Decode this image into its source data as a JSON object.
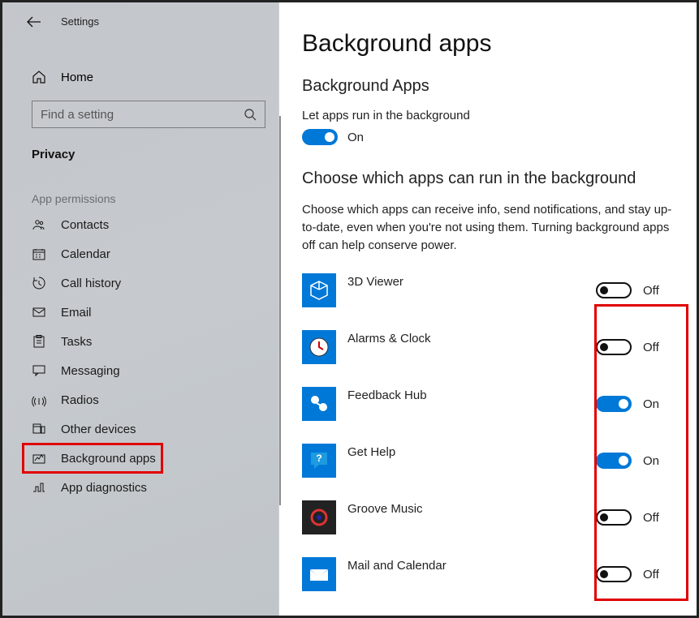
{
  "header": {
    "title": "Settings"
  },
  "sidebar": {
    "home_label": "Home",
    "search_placeholder": "Find a setting",
    "section_heading": "Privacy",
    "group_heading": "App permissions",
    "items": [
      {
        "label": "Contacts",
        "icon": "contacts-icon"
      },
      {
        "label": "Calendar",
        "icon": "calendar-icon"
      },
      {
        "label": "Call history",
        "icon": "call-history-icon"
      },
      {
        "label": "Email",
        "icon": "email-icon"
      },
      {
        "label": "Tasks",
        "icon": "tasks-icon"
      },
      {
        "label": "Messaging",
        "icon": "messaging-icon"
      },
      {
        "label": "Radios",
        "icon": "radios-icon"
      },
      {
        "label": "Other devices",
        "icon": "other-devices-icon"
      },
      {
        "label": "Background apps",
        "icon": "background-apps-icon"
      },
      {
        "label": "App diagnostics",
        "icon": "app-diagnostics-icon"
      }
    ],
    "selected_index": 8
  },
  "main": {
    "page_title": "Background apps",
    "section1_title": "Background Apps",
    "section1_text": "Let apps run in the background",
    "master_toggle": {
      "state": true,
      "label": "On"
    },
    "section2_title": "Choose which apps can run in the background",
    "section2_desc": "Choose which apps can receive info, send notifications, and stay up-to-date, even when you're not using them. Turning background apps off can help conserve power.",
    "apps": [
      {
        "name": "3D Viewer",
        "state": false,
        "label": "Off",
        "icon": "cube-icon"
      },
      {
        "name": "Alarms & Clock",
        "state": false,
        "label": "Off",
        "icon": "clock-icon"
      },
      {
        "name": "Feedback Hub",
        "state": true,
        "label": "On",
        "icon": "feedback-icon"
      },
      {
        "name": "Get Help",
        "state": true,
        "label": "On",
        "icon": "help-icon"
      },
      {
        "name": "Groove Music",
        "state": false,
        "label": "Off",
        "icon": "music-icon"
      },
      {
        "name": "Mail and Calendar",
        "state": false,
        "label": "Off",
        "icon": "mail-icon"
      }
    ]
  }
}
